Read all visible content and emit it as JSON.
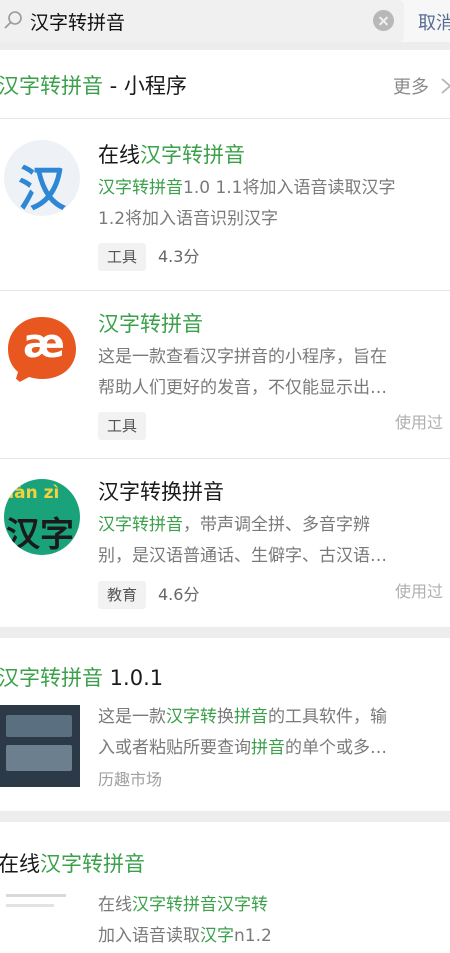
{
  "search": {
    "query": "汉字转拼音",
    "cancel_label": "取消"
  },
  "miniprogram_section": {
    "title_highlight": "汉字转拼音",
    "title_rest": " - 小程序",
    "more_label": "更多"
  },
  "apps": [
    {
      "icon_text": "汉",
      "title_prefix": "在线",
      "title_highlight": "汉字转拼音",
      "title_suffix": "",
      "desc_line1_highlight": "汉字转拼音",
      "desc_line1_rest": "1.0 1.1将加入语音读取汉字",
      "desc_line2": "1.2将加入语音识别汉字",
      "tag": "工具",
      "rating": "4.3分",
      "used": ""
    },
    {
      "icon_text": "æ",
      "title_prefix": "",
      "title_highlight": "汉字转拼音",
      "title_suffix": "",
      "desc_line1_highlight": "",
      "desc_line1_rest": "这是一款查看汉字拼音的小程序，旨在",
      "desc_line2": "帮助人们更好的发音，不仅能显示出…",
      "tag": "工具",
      "rating": "",
      "used": "使用过"
    },
    {
      "icon_text_top": "hàn zì",
      "icon_text_bottom": "汉字",
      "title_prefix": "汉字转换拼音",
      "title_highlight": "",
      "title_suffix": "",
      "desc_line1_highlight": "汉字转拼音",
      "desc_line1_rest": "，带声调全拼、多音字辨",
      "desc_line2": "别，是汉语普通话、生僻字、古汉语…",
      "tag": "教育",
      "rating": "4.6分",
      "used": "使用过"
    }
  ],
  "articles": [
    {
      "title_highlight": "汉字转拼音",
      "title_rest": " 1.0.1",
      "desc_parts": [
        "这是一款",
        "汉字转",
        "换",
        "拼音",
        "的工具软件，输"
      ],
      "desc_line2_parts": [
        "入或者粘贴所要查询",
        "拼音",
        "的单个或多…"
      ],
      "source": "历趣市场"
    },
    {
      "title_prefix": "在线",
      "title_highlight": "汉字转拼音",
      "desc_parts": [
        "在线",
        "汉字转拼音汉字转"
      ],
      "desc_line2_parts": [
        "加入语音读取",
        "汉字",
        "n1.2"
      ]
    }
  ]
}
